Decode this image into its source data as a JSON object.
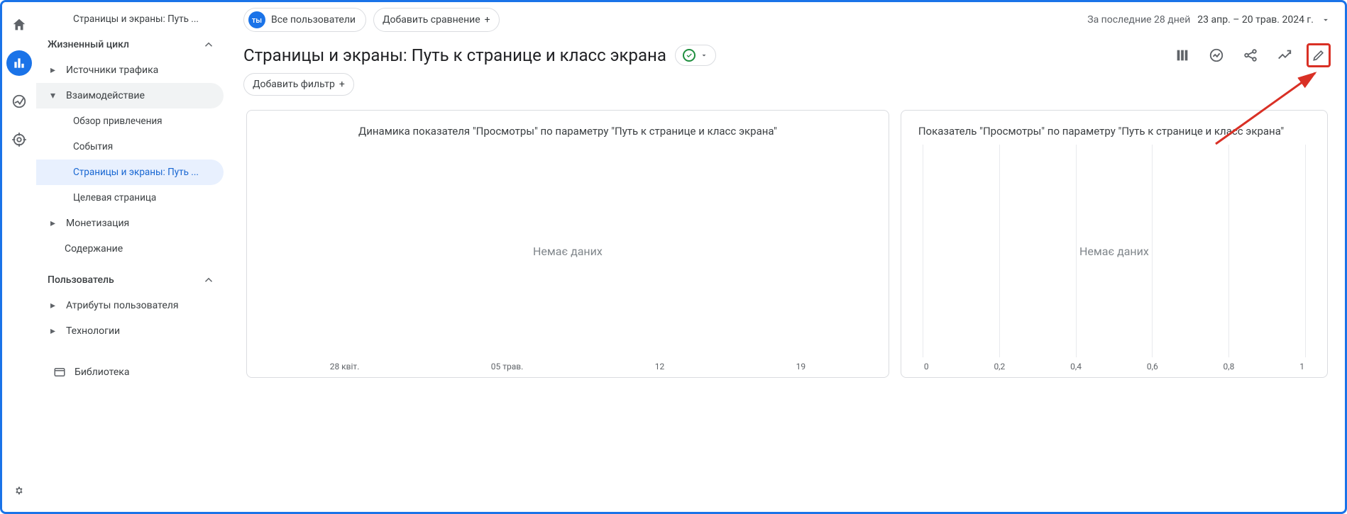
{
  "sidebar": {
    "report_title_crumb": "Страницы и экраны: Путь ...",
    "sections": {
      "lifecycle": {
        "label": "Жизненный цикл",
        "items": [
          {
            "label": "Источники трафика"
          },
          {
            "label": "Взаимодействие",
            "children": [
              {
                "label": "Обзор привлечения"
              },
              {
                "label": "События"
              },
              {
                "label": "Страницы и экраны: Путь ..."
              },
              {
                "label": "Целевая страница"
              }
            ]
          },
          {
            "label": "Монетизация"
          },
          {
            "label": "Содержание"
          }
        ]
      },
      "user": {
        "label": "Пользователь",
        "items": [
          {
            "label": "Атрибуты пользователя"
          },
          {
            "label": "Технологии"
          }
        ]
      }
    },
    "library": "Библиотека"
  },
  "topbar": {
    "segment_badge": "ты",
    "segment_label": "Все пользователи",
    "add_comparison": "Добавить сравнение",
    "date_label": "За последние 28 дней",
    "date_range": "23 апр. – 20 трав. 2024 г."
  },
  "title": "Страницы и экраны: Путь к странице и класс экрана",
  "filter": {
    "add_filter": "Добавить фильтр"
  },
  "cards": {
    "left": {
      "title": "Динамика показателя \"Просмотры\" по параметру \"Путь к странице и класс экрана\"",
      "nodata": "Немає даних"
    },
    "right": {
      "title": "Показатель \"Просмотры\" по параметру \"Путь к странице и класс экрана\"",
      "nodata": "Немає даних"
    }
  },
  "chart_data": [
    {
      "type": "line",
      "title": "Динамика показателя \"Просмотры\" по параметру \"Путь к странице и класс экрана\"",
      "xlabel": "",
      "ylabel": "",
      "x_ticks": [
        "28 квіт.",
        "05 трав.",
        "12",
        "19"
      ],
      "series": [],
      "note": "Немає даних"
    },
    {
      "type": "bar",
      "title": "Показатель \"Просмотры\" по параметру \"Путь к странице и класс экрана\"",
      "xlabel": "",
      "ylabel": "",
      "x_ticks": [
        "0",
        "0,2",
        "0,4",
        "0,6",
        "0,8",
        "1"
      ],
      "xlim": [
        0,
        1
      ],
      "categories": [],
      "values": [],
      "note": "Немає даних"
    }
  ]
}
